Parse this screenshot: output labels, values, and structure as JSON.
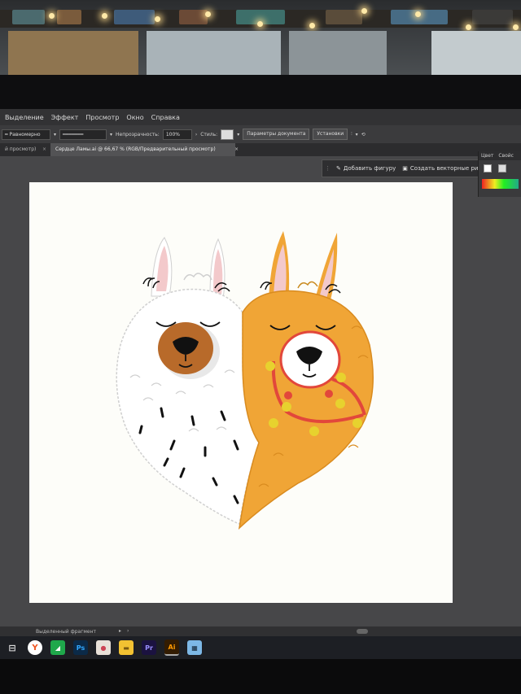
{
  "menu": {
    "items": [
      "Выделение",
      "Эффект",
      "Просмотр",
      "Окно",
      "Справка"
    ]
  },
  "control_bar": {
    "stroke_profile": "Равномерно",
    "opacity_label": "Непрозрачность:",
    "opacity_value": "100%",
    "style_label": "Стиль:",
    "doc_params_button": "Параметры документа",
    "settings_button": "Установки"
  },
  "tabs": {
    "prev_tab": "й просмотр)",
    "active_tab": "Сердце Ламы.ai @ 66,67 % (RGB/Предварительный просмотр)"
  },
  "float_toolbar": {
    "add_shape": "Добавить фигуру",
    "create_vector": "Создать векторные ри"
  },
  "color_panel": {
    "tab_color": "Цвет",
    "tab_properties": "Свойс"
  },
  "status_bar": {
    "selection_label": "Выделенный фрагмент"
  },
  "taskbar": {
    "apps": [
      "task-view",
      "yandex-browser",
      "green-app",
      "photoshop",
      "paint",
      "file-explorer",
      "premiere",
      "illustrator",
      "calculator"
    ],
    "ps_label": "Ps",
    "pr_label": "Pr",
    "ai_label": "Ai"
  },
  "colors": {
    "accent_orange": "#f0a536",
    "llama_white": "#ffffff",
    "harness_red": "#e2473b",
    "pompom_yellow": "#e7d22e",
    "ear_pink": "#f3c9cb"
  }
}
